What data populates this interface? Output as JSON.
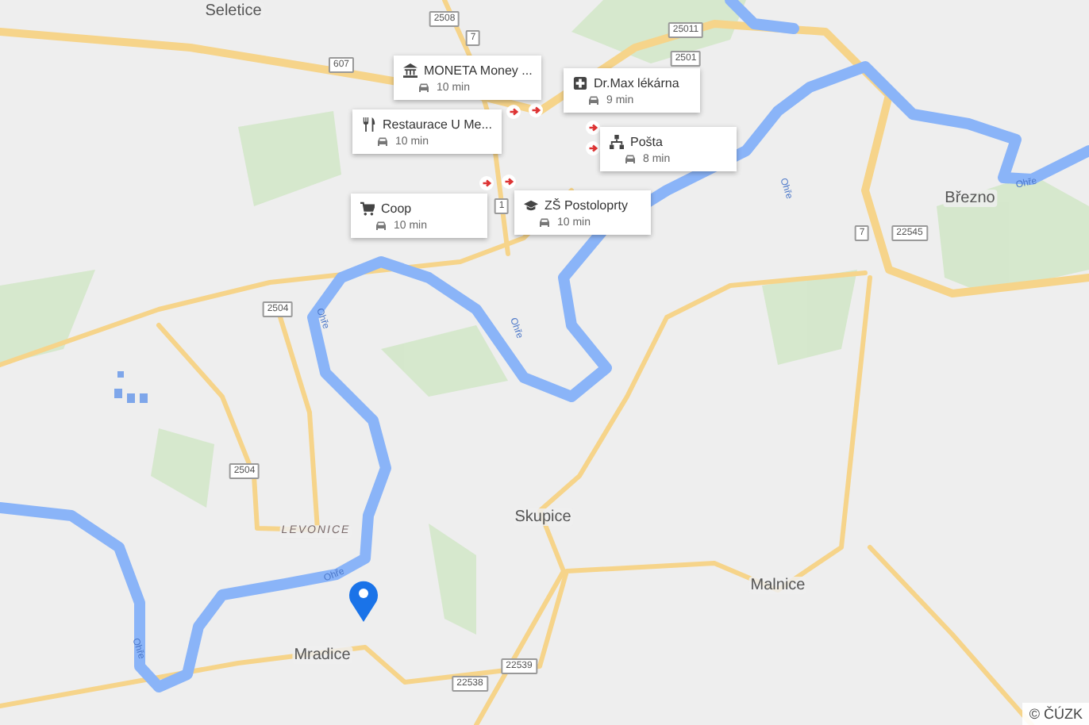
{
  "map": {
    "places": [
      {
        "name": "Seletice",
        "kind": "town"
      },
      {
        "name": "Březno",
        "kind": "town"
      },
      {
        "name": "Skupice",
        "kind": "town"
      },
      {
        "name": "Malnice",
        "kind": "town"
      },
      {
        "name": "Mradice",
        "kind": "town"
      },
      {
        "name": "LEVONICE",
        "kind": "locality"
      }
    ],
    "road_shields": [
      "2508",
      "7",
      "25011",
      "2501",
      "607",
      "1",
      "7",
      "22545",
      "2504",
      "2504",
      "22539",
      "22538"
    ],
    "river_labels": [
      "Ohře",
      "Ohře",
      "Ohře",
      "Ohře",
      "Ohře",
      "Ohře"
    ],
    "poi_cards": [
      {
        "name": "MONETA Money ...",
        "time": "10 min"
      },
      {
        "name": "Dr.Max lékárna",
        "time": "9 min"
      },
      {
        "name": "Restaurace U Me...",
        "time": "10 min"
      },
      {
        "name": "Pošta",
        "time": "8 min"
      },
      {
        "name": "Coop",
        "time": "10 min"
      },
      {
        "name": "ZŠ Postoloprty",
        "time": "10 min"
      }
    ],
    "attribution": "© ČÚZK"
  }
}
